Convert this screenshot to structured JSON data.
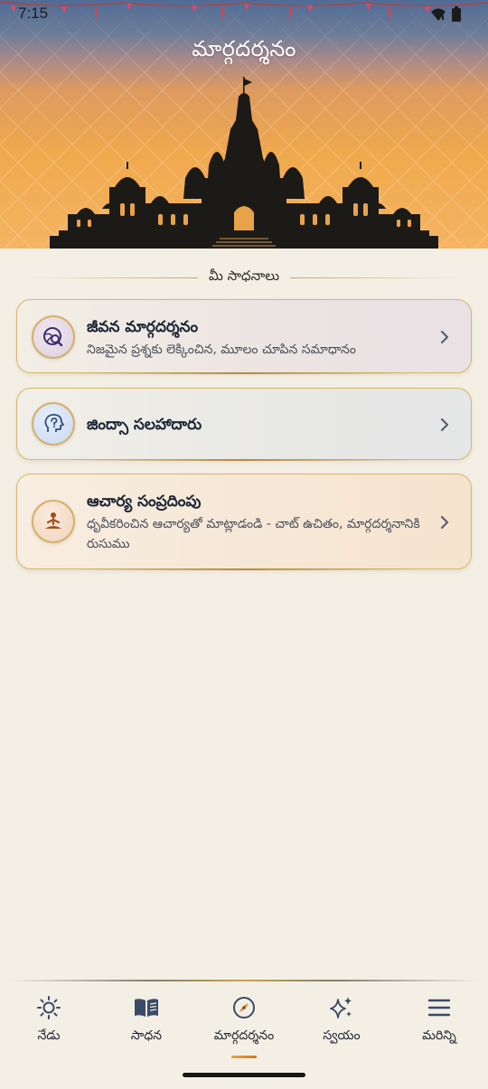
{
  "status_bar": {
    "time": "7:15"
  },
  "header": {
    "title": "మార్గదర్శనం"
  },
  "section": {
    "label": "మీ సాధనాలు"
  },
  "cards": [
    {
      "title": "జీవన మార్గదర్శనం",
      "subtitle": "నిజమైన ప్రశ్నకు లెక్కించిన, మూలం చూపిన సమాధానం",
      "icon": "globe-search-icon",
      "tint": "#ddd0e0"
    },
    {
      "title": "జింద్సా సలహాదారు",
      "subtitle": "",
      "icon": "head-question-icon",
      "tint": "#c9d8f0"
    },
    {
      "title": "ఆచార్య సంప్రదింపు",
      "subtitle": "ధృవీకరించిన ఆచార్యతో మాట్లాడండి - చాట్ ఉచితం, మార్గదర్శనానికి రుసుము",
      "icon": "meditation-icon",
      "tint": "#f0d4bd"
    }
  ],
  "bottom_nav": {
    "active": "మార్గదర్శనం",
    "items": [
      {
        "label": "నేడు",
        "icon": "sun-icon"
      },
      {
        "label": "సాధన",
        "icon": "book-icon"
      },
      {
        "label": "మార్గదర్శనం",
        "icon": "compass-icon"
      },
      {
        "label": "స్వయం",
        "icon": "sparkles-icon"
      },
      {
        "label": "మరిన్ని",
        "icon": "menu-icon"
      }
    ]
  },
  "colors": {
    "accent_gold": "#c9a355",
    "background": "#f3efe4",
    "header_top": "#4f6c95",
    "header_bottom": "#f5b462",
    "text_primary": "#1c2535"
  }
}
